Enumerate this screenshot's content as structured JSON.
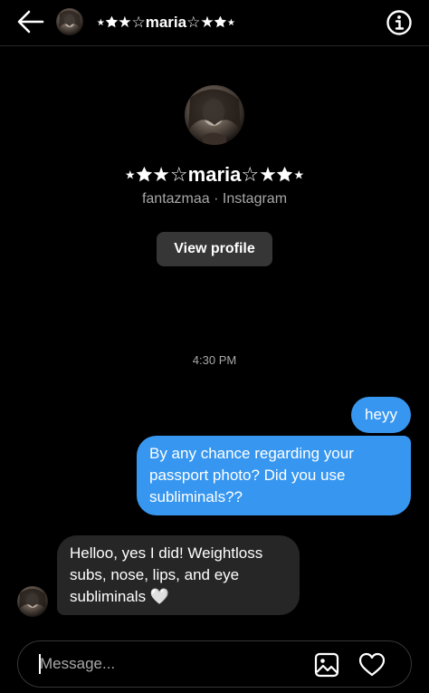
{
  "header": {
    "title": "⋆🟊★☆maria☆★🟊⋆",
    "back_icon": "arrow-left-icon",
    "info_icon": "info-circle-icon"
  },
  "profile": {
    "display_name": "⋆🟊★☆maria☆★🟊⋆",
    "subtitle": "fantazmaa · Instagram",
    "view_profile_label": "View profile"
  },
  "thread": {
    "timestamp": "4:30 PM",
    "messages": [
      {
        "direction": "outgoing",
        "text": "heyy"
      },
      {
        "direction": "outgoing",
        "text": "By any chance regarding your passport photo? Did you use subliminals??"
      },
      {
        "direction": "incoming",
        "text": "Helloo, yes I did! Weightloss subs, nose, lips, and eye subliminals 🤍"
      }
    ]
  },
  "composer": {
    "placeholder": "Message...",
    "value": "",
    "gallery_icon": "image-icon",
    "like_icon": "heart-icon"
  },
  "colors": {
    "background": "#000000",
    "outgoing_bubble": "#3797f0",
    "incoming_bubble": "#262626",
    "secondary_text": "#a8a8a8"
  }
}
